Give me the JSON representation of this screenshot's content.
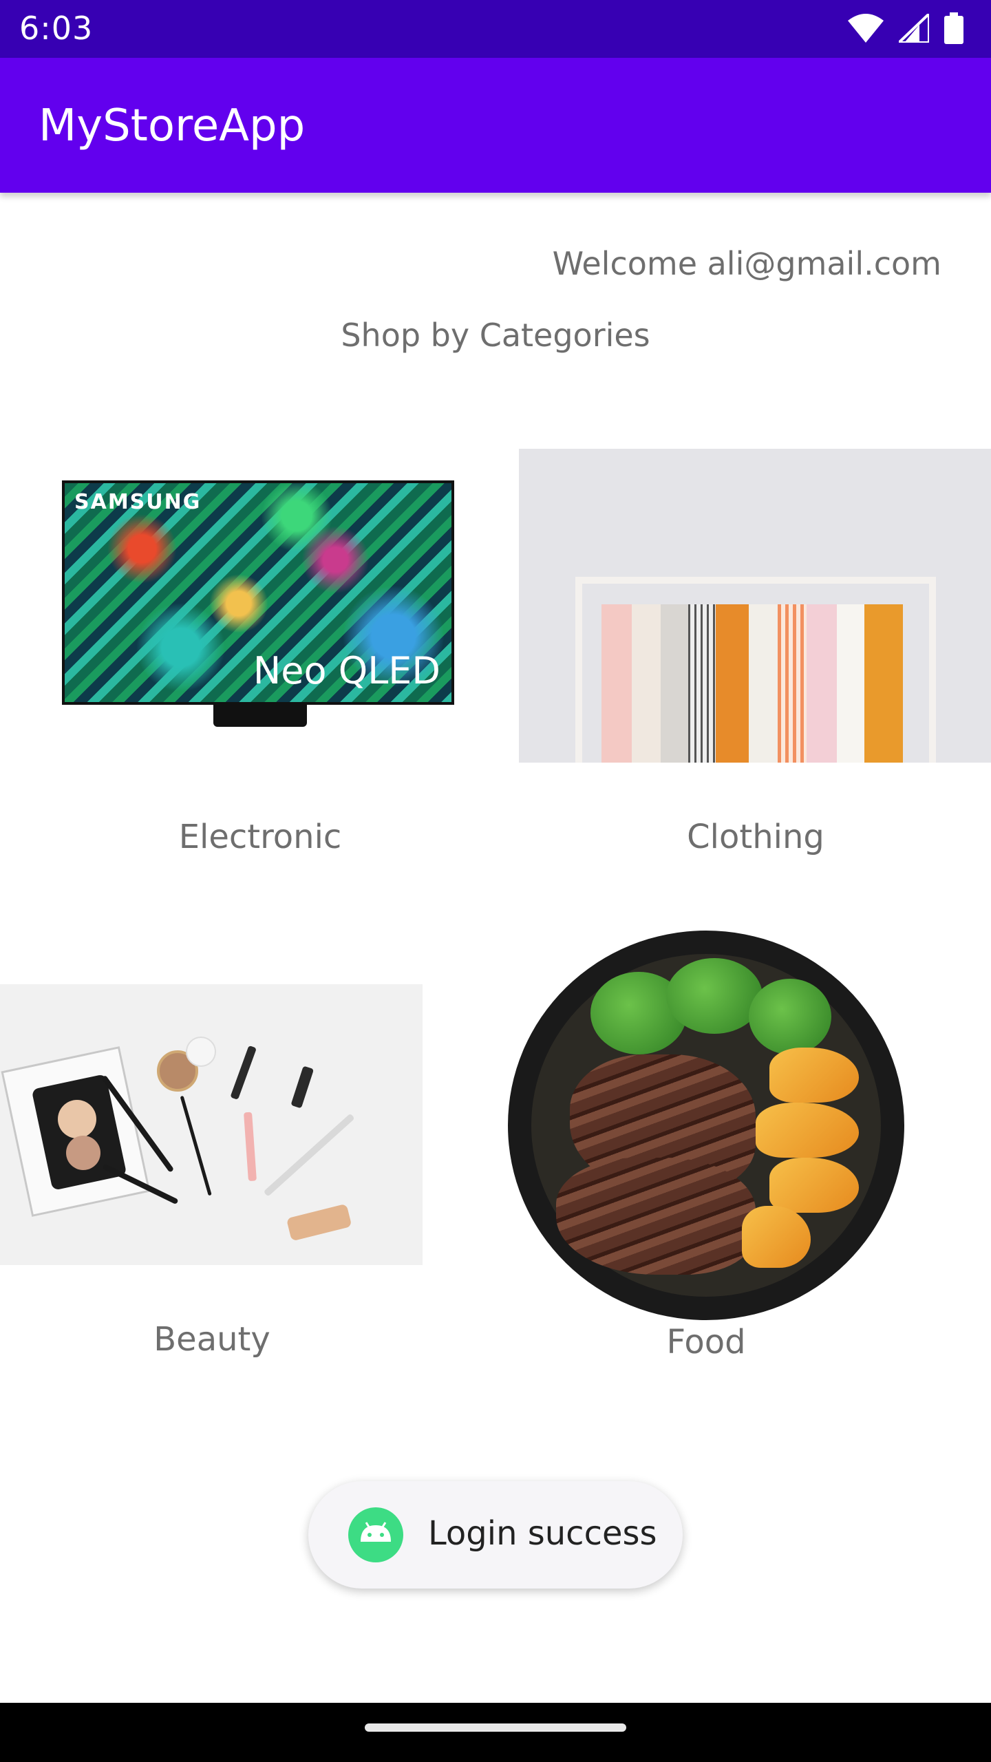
{
  "status_bar": {
    "time": "6:03"
  },
  "app_bar": {
    "title": "MyStoreApp"
  },
  "main": {
    "welcome": "Welcome ali@gmail.com",
    "section_title": "Shop by Categories",
    "categories": [
      {
        "label": "Electronic",
        "image": "samsung-tv-image"
      },
      {
        "label": "Clothing",
        "image": "clothing-rack-image"
      },
      {
        "label": "Beauty",
        "image": "makeup-products-image"
      },
      {
        "label": "Food",
        "image": "steak-plate-image"
      }
    ],
    "tv_brand": "SAMSUNG",
    "tv_model": "Neo QLED"
  },
  "toast": {
    "message": "Login success",
    "icon": "android-icon"
  },
  "colors": {
    "status_bar": "#3700b3",
    "app_bar": "#6200ee",
    "text_secondary": "#6e6e6e"
  }
}
